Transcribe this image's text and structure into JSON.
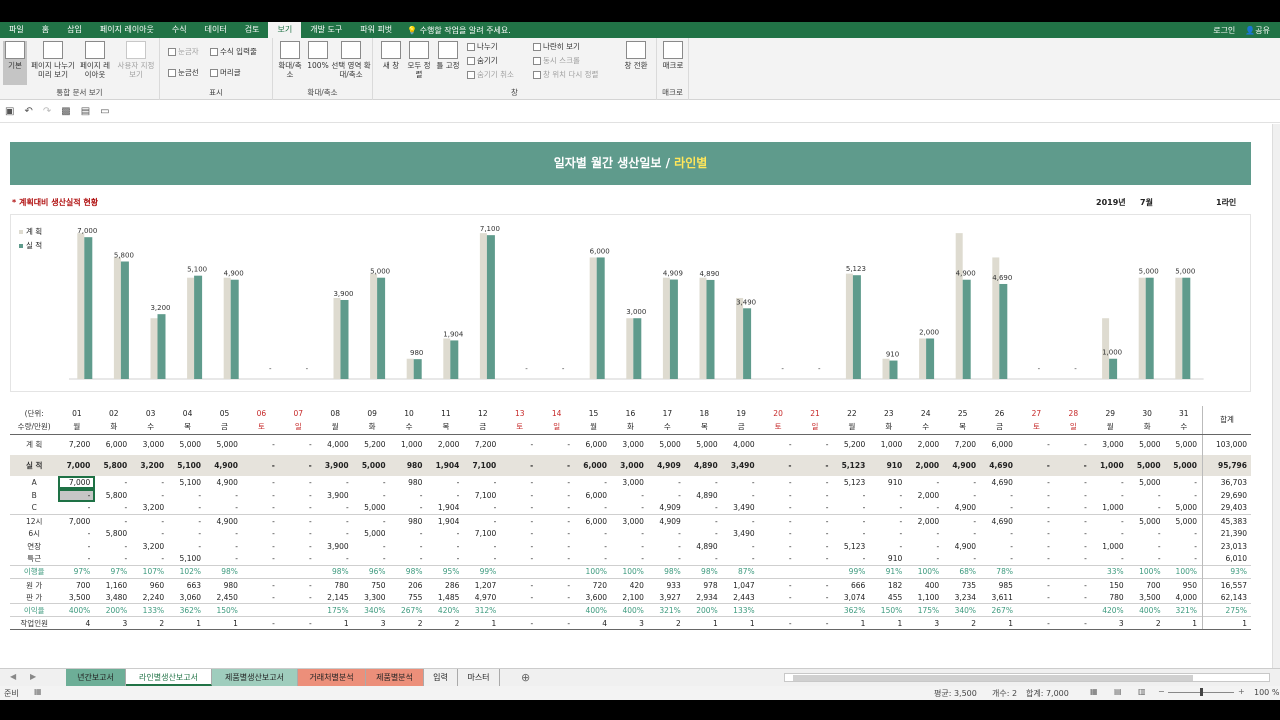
{
  "ribbon_tabs": [
    "파일",
    "홈",
    "삽입",
    "페이지 레이아웃",
    "수식",
    "데이터",
    "검토",
    "보기",
    "개발 도구",
    "파워 피벗"
  ],
  "active_tab": "보기",
  "tell_me": "수행할 작업을 알려 주세요.",
  "login": "로그인",
  "share": "공유",
  "ribbon": {
    "workbook_views": {
      "label": "통합 문서 보기",
      "normal": "기본",
      "page_break": "페이지 나누기 미리 보기",
      "page_layout": "페이지 레이아웃",
      "custom": "사용자 지정 보기"
    },
    "show": {
      "label": "표시",
      "ruler": "눈금자",
      "formula_bar": "수식 입력줄",
      "gridlines": "눈금선",
      "headings": "머리글"
    },
    "zoom": {
      "label": "확대/축소",
      "zoom": "확대/축소",
      "hundred": "100%",
      "to_selection": "선택 영역 확대/축소"
    },
    "window": {
      "label": "창",
      "new_window": "새 창",
      "arrange_all": "모두 정렬",
      "freeze": "틀 고정",
      "split": "나누기",
      "hide": "숨기기",
      "unhide": "숨기기 취소",
      "side_by_side": "나란히 보기",
      "sync_scroll": "동시 스크롤",
      "reset_pos": "창 위치 다시 정렬",
      "switch": "창 전환"
    },
    "macros": {
      "label": "매크로",
      "macros": "매크로"
    }
  },
  "report": {
    "title_main": "일자별 월간 생산일보 / ",
    "title_highlight": "라인별",
    "subtitle": "* 계획대비 생산실적 현황",
    "year": "2019년",
    "month": "7월",
    "line": "1라인"
  },
  "colors": {
    "plan": "#dedbd0",
    "actual": "#5f9b8c",
    "banner": "#5f9b8c",
    "weekend": "#c62828",
    "rate": "#3d9a7e"
  },
  "chart_data": {
    "type": "bar",
    "categories": [
      "01",
      "02",
      "03",
      "04",
      "05",
      "06",
      "07",
      "08",
      "09",
      "10",
      "11",
      "12",
      "13",
      "14",
      "15",
      "16",
      "17",
      "18",
      "19",
      "20",
      "21",
      "22",
      "23",
      "24",
      "25",
      "26",
      "27",
      "28",
      "29",
      "30",
      "31"
    ],
    "series": [
      {
        "name": "계 획",
        "values": [
          7200,
          6000,
          3000,
          5000,
          5000,
          0,
          0,
          4000,
          5200,
          1000,
          2000,
          7200,
          0,
          0,
          6000,
          3000,
          5000,
          5000,
          4000,
          0,
          0,
          5200,
          1000,
          2000,
          7200,
          6000,
          0,
          0,
          3000,
          5000,
          5000
        ]
      },
      {
        "name": "실 적",
        "values": [
          7000,
          5800,
          3200,
          5100,
          4900,
          0,
          0,
          3900,
          5000,
          980,
          1904,
          7100,
          0,
          0,
          6000,
          3000,
          4909,
          4890,
          3490,
          0,
          0,
          5123,
          910,
          2000,
          4900,
          4690,
          0,
          0,
          1000,
          5000,
          5000
        ]
      }
    ],
    "data_labels": [
      "7,000",
      "5,800",
      "3,200",
      "5,100",
      "4,900",
      "-",
      "-",
      "3,900",
      "5,000",
      "980",
      "1,904",
      "7,100",
      "-",
      "-",
      "6,000",
      "3,000",
      "4,909",
      "4,890",
      "3,490",
      "-",
      "-",
      "5,123",
      "910",
      "2,000",
      "4,900",
      "4,690",
      "-",
      "-",
      "1,000",
      "5,000",
      "5,000"
    ],
    "ylim": [
      0,
      7700
    ],
    "legend": "top-left",
    "grid": false
  },
  "table": {
    "unit_label_1": "(단위:",
    "unit_label_2": "수량/만원)",
    "total_header": "합계",
    "days": [
      "01",
      "02",
      "03",
      "04",
      "05",
      "06",
      "07",
      "08",
      "09",
      "10",
      "11",
      "12",
      "13",
      "14",
      "15",
      "16",
      "17",
      "18",
      "19",
      "20",
      "21",
      "22",
      "23",
      "24",
      "25",
      "26",
      "27",
      "28",
      "29",
      "30",
      "31"
    ],
    "weekdays": [
      "월",
      "화",
      "수",
      "목",
      "금",
      "토",
      "일",
      "월",
      "화",
      "수",
      "목",
      "금",
      "토",
      "일",
      "월",
      "화",
      "수",
      "목",
      "금",
      "토",
      "일",
      "월",
      "화",
      "수",
      "목",
      "금",
      "토",
      "일",
      "월",
      "화",
      "수"
    ],
    "rows": [
      {
        "label": "계 획",
        "cls": "",
        "cells": [
          "7,200",
          "6,000",
          "3,000",
          "5,000",
          "5,000",
          "-",
          "-",
          "4,000",
          "5,200",
          "1,000",
          "2,000",
          "7,200",
          "-",
          "-",
          "6,000",
          "3,000",
          "5,000",
          "5,000",
          "4,000",
          "-",
          "-",
          "5,200",
          "1,000",
          "2,000",
          "7,200",
          "6,000",
          "-",
          "-",
          "3,000",
          "5,000",
          "5,000"
        ],
        "total": "103,000"
      },
      {
        "label": "실 적",
        "cls": "shade",
        "cells": [
          "7,000",
          "5,800",
          "3,200",
          "5,100",
          "4,900",
          "-",
          "-",
          "3,900",
          "5,000",
          "980",
          "1,904",
          "7,100",
          "-",
          "-",
          "6,000",
          "3,000",
          "4,909",
          "4,890",
          "3,490",
          "-",
          "-",
          "5,123",
          "910",
          "2,000",
          "4,900",
          "4,690",
          "-",
          "-",
          "1,000",
          "5,000",
          "5,000"
        ],
        "total": "95,796"
      },
      {
        "label": "A",
        "cls": "",
        "cells": [
          "7,000",
          "-",
          "-",
          "5,100",
          "4,900",
          "-",
          "-",
          "-",
          "-",
          "980",
          "-",
          "-",
          "-",
          "-",
          "-",
          "3,000",
          "-",
          "-",
          "-",
          "-",
          "-",
          "5,123",
          "910",
          "-",
          "-",
          "4,690",
          "-",
          "-",
          "-",
          "5,000",
          "-"
        ],
        "total": "36,703"
      },
      {
        "label": "B",
        "cls": "",
        "cells": [
          "-",
          "5,800",
          "-",
          "-",
          "-",
          "-",
          "-",
          "3,900",
          "-",
          "-",
          "-",
          "7,100",
          "-",
          "-",
          "6,000",
          "-",
          "-",
          "4,890",
          "-",
          "-",
          "-",
          "-",
          "-",
          "2,000",
          "-",
          "-",
          "-",
          "-",
          "-",
          "-",
          "-"
        ],
        "total": "29,690"
      },
      {
        "label": "C",
        "cls": "",
        "cells": [
          "-",
          "-",
          "3,200",
          "-",
          "-",
          "-",
          "-",
          "-",
          "5,000",
          "-",
          "1,904",
          "-",
          "-",
          "-",
          "-",
          "-",
          "4,909",
          "-",
          "3,490",
          "-",
          "-",
          "-",
          "-",
          "-",
          "4,900",
          "-",
          "-",
          "-",
          "1,000",
          "-",
          "5,000"
        ],
        "total": "29,403"
      },
      {
        "label": "12시",
        "cls": "topline",
        "cells": [
          "7,000",
          "-",
          "-",
          "-",
          "4,900",
          "-",
          "-",
          "-",
          "-",
          "980",
          "1,904",
          "-",
          "-",
          "-",
          "6,000",
          "3,000",
          "4,909",
          "-",
          "-",
          "-",
          "-",
          "-",
          "-",
          "2,000",
          "-",
          "4,690",
          "-",
          "-",
          "-",
          "5,000",
          "5,000"
        ],
        "total": "45,383"
      },
      {
        "label": "6시",
        "cls": "",
        "cells": [
          "-",
          "5,800",
          "-",
          "-",
          "-",
          "-",
          "-",
          "-",
          "5,000",
          "-",
          "-",
          "7,100",
          "-",
          "-",
          "-",
          "-",
          "-",
          "-",
          "3,490",
          "-",
          "-",
          "-",
          "-",
          "-",
          "-",
          "-",
          "-",
          "-",
          "-",
          "-",
          "-"
        ],
        "total": "21,390"
      },
      {
        "label": "연장",
        "cls": "",
        "cells": [
          "-",
          "-",
          "3,200",
          "-",
          "-",
          "-",
          "-",
          "3,900",
          "-",
          "-",
          "-",
          "-",
          "-",
          "-",
          "-",
          "-",
          "-",
          "4,890",
          "-",
          "-",
          "-",
          "5,123",
          "-",
          "-",
          "4,900",
          "-",
          "-",
          "-",
          "1,000",
          "-",
          "-"
        ],
        "total": "23,013"
      },
      {
        "label": "특근",
        "cls": "",
        "cells": [
          "-",
          "-",
          "-",
          "5,100",
          "-",
          "-",
          "-",
          "-",
          "-",
          "-",
          "-",
          "-",
          "-",
          "-",
          "-",
          "-",
          "-",
          "-",
          "-",
          "-",
          "-",
          "-",
          "910",
          "-",
          "-",
          "-",
          "-",
          "-",
          "-",
          "-",
          "-"
        ],
        "total": "6,010"
      },
      {
        "label": "이행율",
        "cls": "green topline",
        "cells": [
          "97%",
          "97%",
          "107%",
          "102%",
          "98%",
          "",
          "",
          "98%",
          "96%",
          "98%",
          "95%",
          "99%",
          "",
          "",
          "100%",
          "100%",
          "98%",
          "98%",
          "87%",
          "",
          "",
          "99%",
          "91%",
          "100%",
          "68%",
          "78%",
          "",
          "",
          "33%",
          "100%",
          "100%"
        ],
        "total": "93%"
      },
      {
        "label": "원 가",
        "cls": "topline",
        "cells": [
          "700",
          "1,160",
          "960",
          "663",
          "980",
          "-",
          "-",
          "780",
          "750",
          "206",
          "286",
          "1,207",
          "-",
          "-",
          "720",
          "420",
          "933",
          "978",
          "1,047",
          "-",
          "-",
          "666",
          "182",
          "400",
          "735",
          "985",
          "-",
          "-",
          "150",
          "700",
          "950"
        ],
        "total": "16,557"
      },
      {
        "label": "판 가",
        "cls": "",
        "cells": [
          "3,500",
          "3,480",
          "2,240",
          "3,060",
          "2,450",
          "-",
          "-",
          "2,145",
          "3,300",
          "755",
          "1,485",
          "4,970",
          "-",
          "-",
          "3,600",
          "2,100",
          "3,927",
          "2,934",
          "2,443",
          "-",
          "-",
          "3,074",
          "455",
          "1,100",
          "3,234",
          "3,611",
          "-",
          "-",
          "780",
          "3,500",
          "4,000"
        ],
        "total": "62,143"
      },
      {
        "label": "이익율",
        "cls": "green topline",
        "cells": [
          "400%",
          "200%",
          "133%",
          "362%",
          "150%",
          "",
          "",
          "175%",
          "340%",
          "267%",
          "420%",
          "312%",
          "",
          "",
          "400%",
          "400%",
          "321%",
          "200%",
          "133%",
          "",
          "",
          "362%",
          "150%",
          "175%",
          "340%",
          "267%",
          "",
          "",
          "420%",
          "400%",
          "321%"
        ],
        "total": "275%"
      },
      {
        "label": "작업인원",
        "cls": "topline sep",
        "cells": [
          "4",
          "3",
          "2",
          "1",
          "1",
          "-",
          "-",
          "1",
          "3",
          "2",
          "2",
          "1",
          "-",
          "-",
          "4",
          "3",
          "2",
          "1",
          "1",
          "-",
          "-",
          "1",
          "1",
          "3",
          "2",
          "1",
          "-",
          "-",
          "3",
          "2",
          "1"
        ],
        "total": "1"
      }
    ]
  },
  "sheet_tabs": [
    "년간보고서",
    "라인별생산보고서",
    "제품별생산보고서",
    "거래처별분석",
    "제품별분석",
    "입력",
    "마스터"
  ],
  "status": {
    "ready": "준비",
    "average": "평균: 3,500",
    "count": "개수: 2",
    "sum": "합계: 7,000",
    "zoom": "100 %"
  }
}
